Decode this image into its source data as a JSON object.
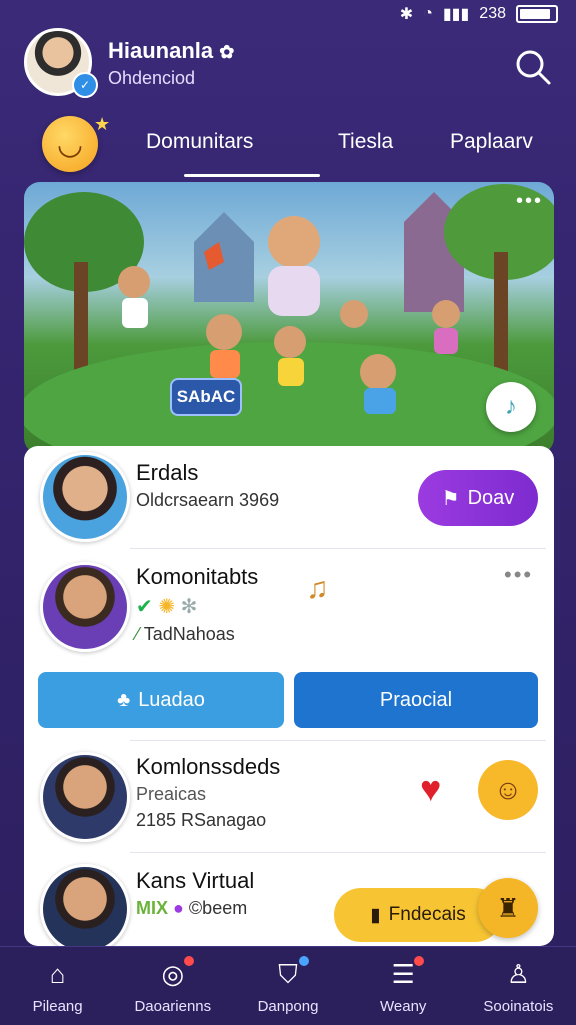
{
  "status_bar": {
    "icons": [
      "bluetooth-icon",
      "wifi-icon",
      "signal-icon"
    ],
    "time": "238"
  },
  "header": {
    "name": "Hiaunanla",
    "subtitle": "Ohdenciod"
  },
  "tabs": [
    {
      "label": "Domunitars",
      "active": true
    },
    {
      "label": "Tiesla",
      "active": false
    },
    {
      "label": "Paplaarv",
      "active": false
    }
  ],
  "banner": {
    "badge_text": "SAbAC"
  },
  "rows": [
    {
      "title": "Erdals",
      "subtitle": "Oldcrsaearn 3969",
      "button": "Doav"
    },
    {
      "title": "Komonitabts",
      "meta": "TadNahoas"
    },
    {
      "title": "Komlonssdeds",
      "line1": "Preaicas",
      "line2": "2185 RSanagao"
    },
    {
      "title": "Kans Virtual",
      "tag": "MIX",
      "meta": "©beem"
    }
  ],
  "actions": {
    "left": "Luadao",
    "right": "Praocial"
  },
  "cta": {
    "label": "Fndecais"
  },
  "nav": [
    {
      "label": "Pileang",
      "icon": "home-icon"
    },
    {
      "label": "Daoarienns",
      "icon": "search-chat-icon"
    },
    {
      "label": "Danpong",
      "icon": "shield-icon"
    },
    {
      "label": "Weany",
      "icon": "list-icon"
    },
    {
      "label": "Sooinatois",
      "icon": "profile-icon"
    }
  ],
  "colors": {
    "background": "#34246e",
    "accent_purple": "#8b33d8",
    "accent_blue": "#1e74cf",
    "accent_yellow": "#f7c533"
  }
}
